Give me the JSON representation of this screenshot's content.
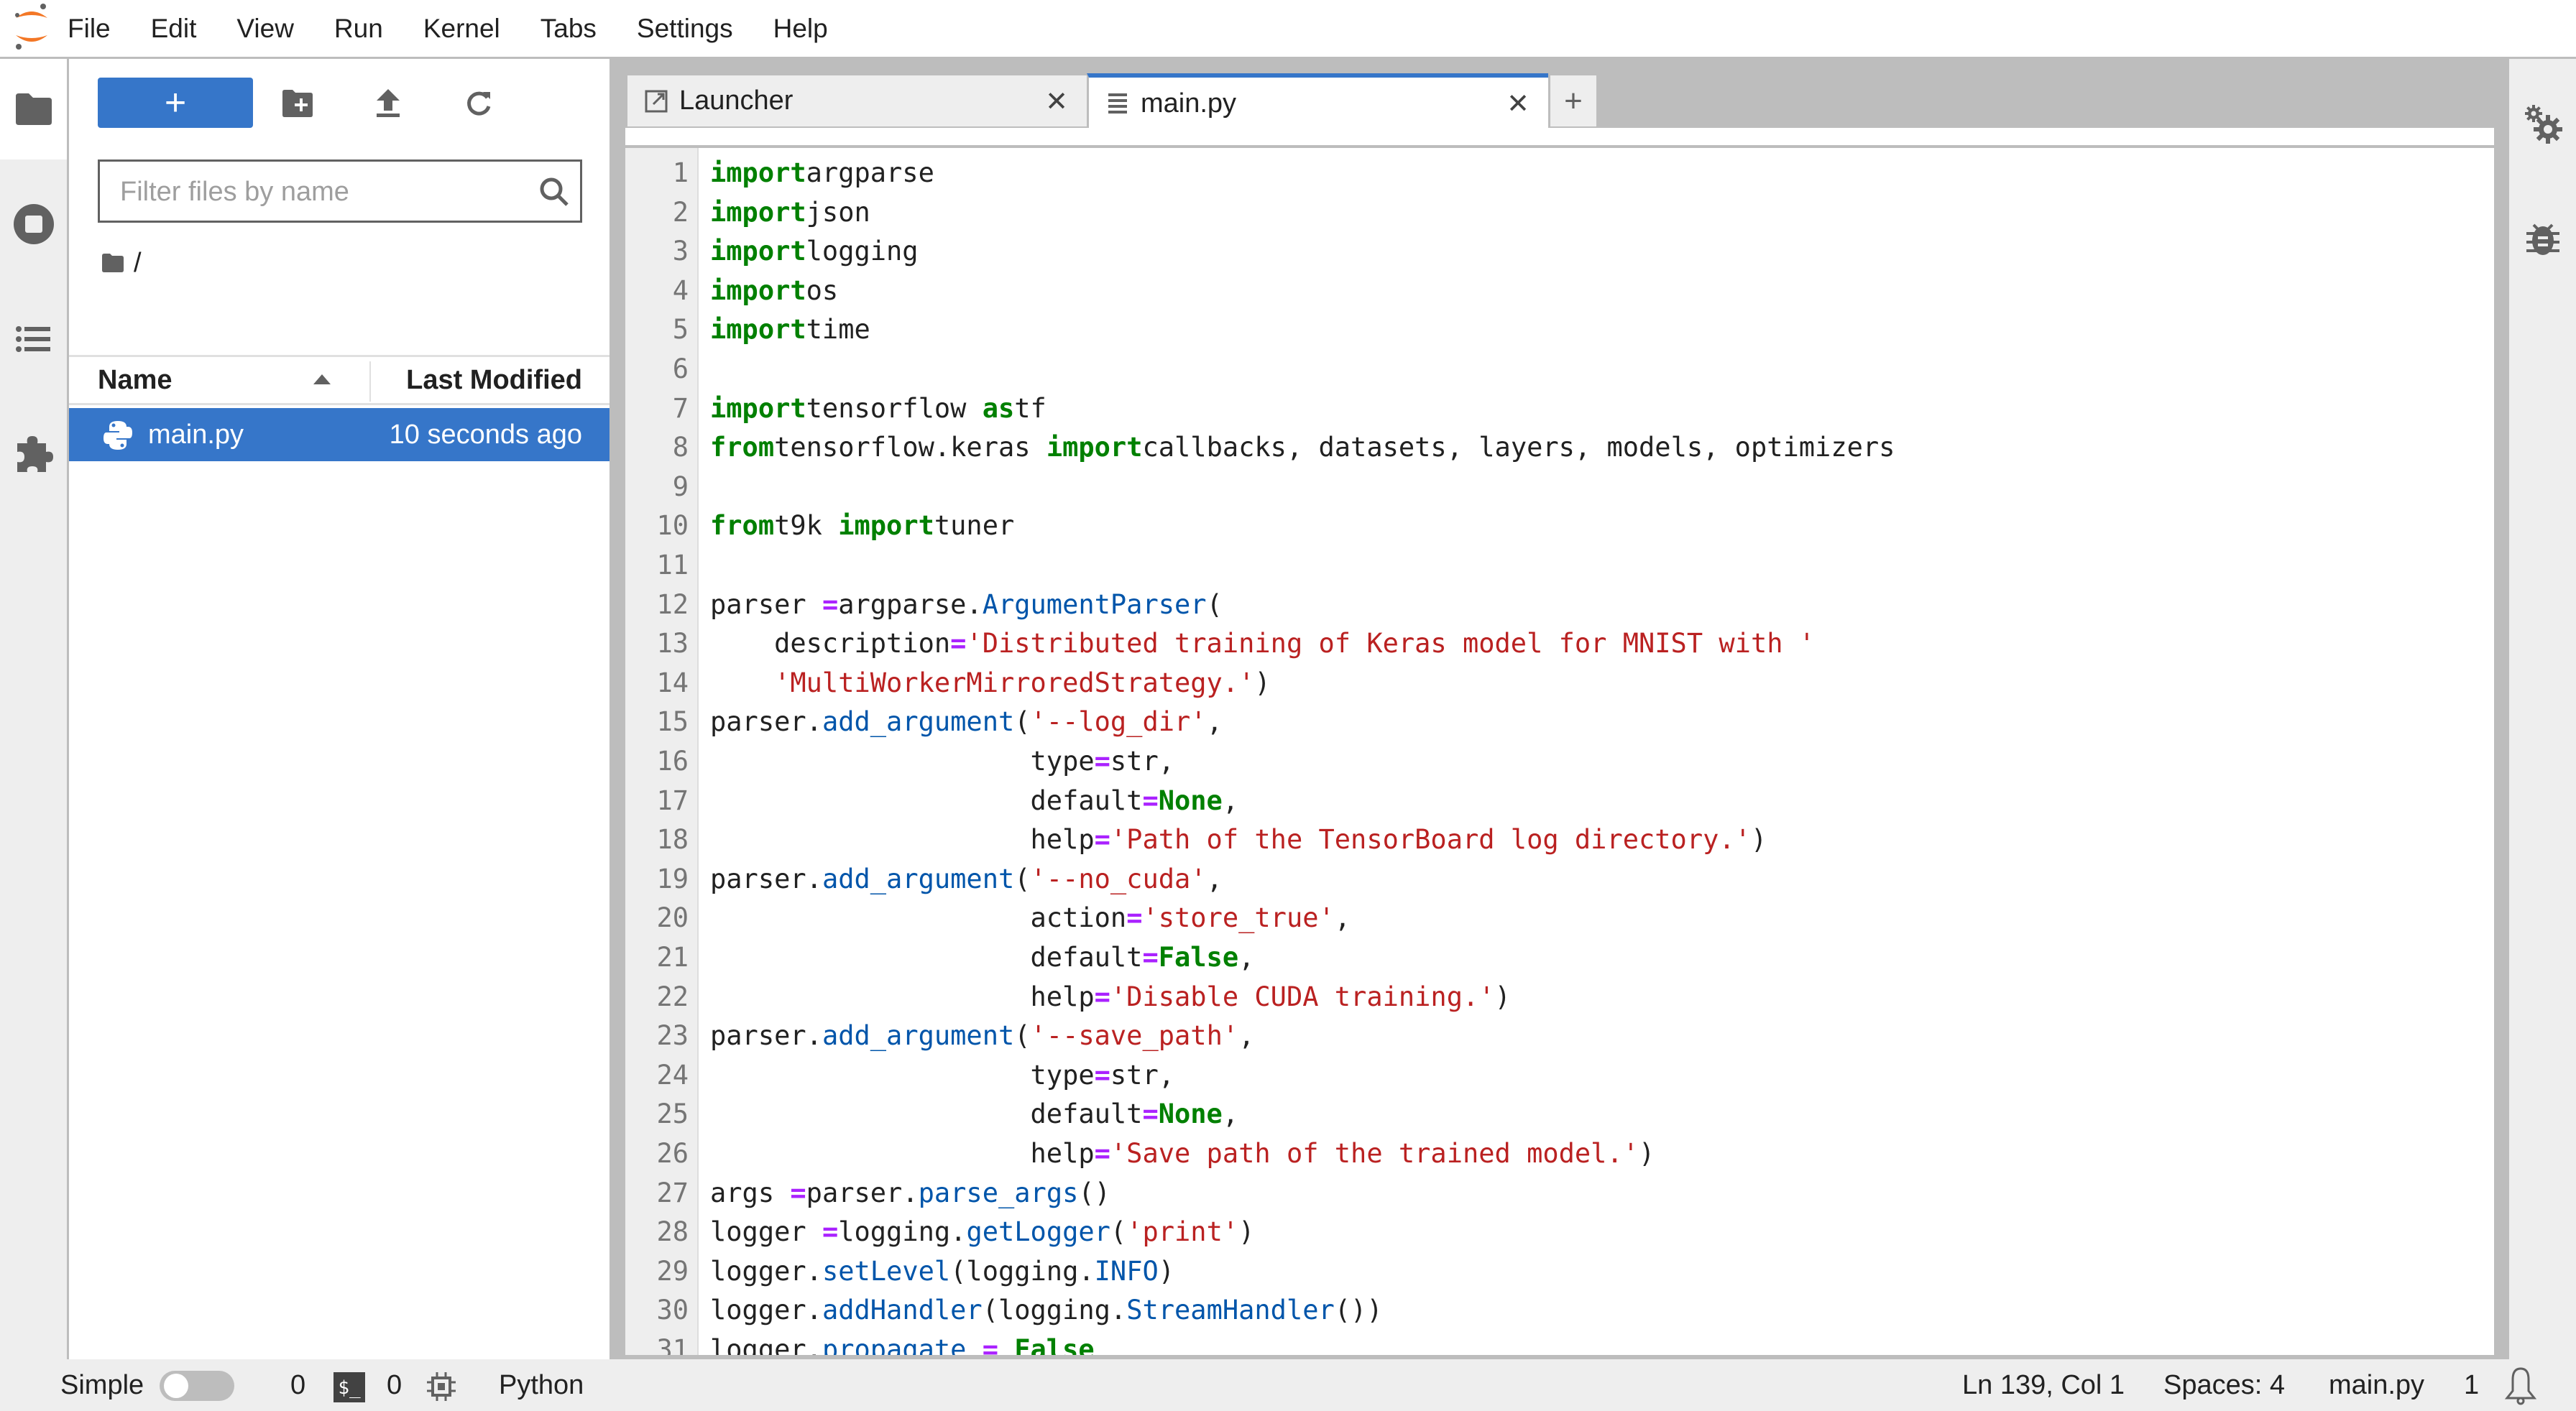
{
  "menubar": {
    "logo": "jupyter-logo",
    "items": [
      "File",
      "Edit",
      "View",
      "Run",
      "Kernel",
      "Tabs",
      "Settings",
      "Help"
    ]
  },
  "left_sidebar": {
    "items": [
      {
        "name": "file-browser",
        "icon": "folder-icon",
        "active": true
      },
      {
        "name": "running-kernels",
        "icon": "stop-circle-icon"
      },
      {
        "name": "table-of-contents",
        "icon": "list-icon"
      },
      {
        "name": "extension-manager",
        "icon": "puzzle-icon"
      }
    ]
  },
  "file_browser": {
    "new_label": "+",
    "toolbar_icons": [
      "new-folder-icon",
      "upload-icon",
      "refresh-icon"
    ],
    "filter_placeholder": "Filter files by name",
    "filter_value": "",
    "breadcrumb": "/",
    "columns": {
      "name": "Name",
      "modified": "Last Modified"
    },
    "files": [
      {
        "name": "main.py",
        "modified": "10 seconds ago",
        "icon": "python-icon",
        "selected": true
      }
    ]
  },
  "tabs": [
    {
      "label": "Launcher",
      "icon": "launcher-icon",
      "active": false
    },
    {
      "label": "main.py",
      "icon": "text-file-icon",
      "active": true
    }
  ],
  "add_tab_label": "+",
  "editor": {
    "language": "python",
    "lines": [
      [
        [
          "kw",
          "import"
        ],
        [
          "",
          "argparse"
        ]
      ],
      [
        [
          "kw",
          "import"
        ],
        [
          "",
          "json"
        ]
      ],
      [
        [
          "kw",
          "import"
        ],
        [
          "",
          "logging"
        ]
      ],
      [
        [
          "kw",
          "import"
        ],
        [
          "",
          "os"
        ]
      ],
      [
        [
          "kw",
          "import"
        ],
        [
          "",
          "time"
        ]
      ],
      [],
      [
        [
          "kw",
          "import"
        ],
        [
          "",
          "tensorflow "
        ],
        [
          "kw",
          "as"
        ],
        [
          "",
          "tf"
        ]
      ],
      [
        [
          "kw",
          "from"
        ],
        [
          "",
          "tensorflow.keras "
        ],
        [
          "kw",
          "import"
        ],
        [
          "",
          "callbacks, datasets, layers, models, optimizers"
        ]
      ],
      [],
      [
        [
          "kw",
          "from"
        ],
        [
          "",
          "t9k "
        ],
        [
          "kw",
          "import"
        ],
        [
          "",
          "tuner"
        ]
      ],
      [],
      [
        [
          "",
          "parser "
        ],
        [
          "op",
          "="
        ],
        [
          "",
          "argparse."
        ],
        [
          "fn",
          "ArgumentParser"
        ],
        [
          "",
          "("
        ]
      ],
      [
        [
          "",
          "    description"
        ],
        [
          "op",
          "="
        ],
        [
          "str",
          "'Distributed training of Keras model for MNIST with '"
        ]
      ],
      [
        [
          "",
          "    "
        ],
        [
          "str",
          "'MultiWorkerMirroredStrategy.'"
        ],
        [
          "",
          ")"
        ]
      ],
      [
        [
          "",
          "parser."
        ],
        [
          "fn",
          "add_argument"
        ],
        [
          "",
          "("
        ],
        [
          "str",
          "'--log_dir'"
        ],
        [
          "",
          ","
        ]
      ],
      [
        [
          "",
          "                    type"
        ],
        [
          "op",
          "="
        ],
        [
          "",
          "str,"
        ]
      ],
      [
        [
          "",
          "                    default"
        ],
        [
          "op",
          "="
        ],
        [
          "cst",
          "None"
        ],
        [
          "",
          ","
        ]
      ],
      [
        [
          "",
          "                    help"
        ],
        [
          "op",
          "="
        ],
        [
          "str",
          "'Path of the TensorBoard log directory.'"
        ],
        [
          "",
          ")"
        ]
      ],
      [
        [
          "",
          "parser."
        ],
        [
          "fn",
          "add_argument"
        ],
        [
          "",
          "("
        ],
        [
          "str",
          "'--no_cuda'"
        ],
        [
          "",
          ","
        ]
      ],
      [
        [
          "",
          "                    action"
        ],
        [
          "op",
          "="
        ],
        [
          "str",
          "'store_true'"
        ],
        [
          "",
          ","
        ]
      ],
      [
        [
          "",
          "                    default"
        ],
        [
          "op",
          "="
        ],
        [
          "cst",
          "False"
        ],
        [
          "",
          ","
        ]
      ],
      [
        [
          "",
          "                    help"
        ],
        [
          "op",
          "="
        ],
        [
          "str",
          "'Disable CUDA training.'"
        ],
        [
          "",
          ")"
        ]
      ],
      [
        [
          "",
          "parser."
        ],
        [
          "fn",
          "add_argument"
        ],
        [
          "",
          "("
        ],
        [
          "str",
          "'--save_path'"
        ],
        [
          "",
          ","
        ]
      ],
      [
        [
          "",
          "                    type"
        ],
        [
          "op",
          "="
        ],
        [
          "",
          "str,"
        ]
      ],
      [
        [
          "",
          "                    default"
        ],
        [
          "op",
          "="
        ],
        [
          "cst",
          "None"
        ],
        [
          "",
          ","
        ]
      ],
      [
        [
          "",
          "                    help"
        ],
        [
          "op",
          "="
        ],
        [
          "str",
          "'Save path of the trained model.'"
        ],
        [
          "",
          ")"
        ]
      ],
      [
        [
          "",
          "args "
        ],
        [
          "op",
          "="
        ],
        [
          "",
          "parser."
        ],
        [
          "fn",
          "parse_args"
        ],
        [
          "",
          "()"
        ]
      ],
      [
        [
          "",
          "logger "
        ],
        [
          "op",
          "="
        ],
        [
          "",
          "logging."
        ],
        [
          "fn",
          "getLogger"
        ],
        [
          "",
          "("
        ],
        [
          "str",
          "'print'"
        ],
        [
          "",
          ")"
        ]
      ],
      [
        [
          "",
          "logger."
        ],
        [
          "fn",
          "setLevel"
        ],
        [
          "",
          "(logging."
        ],
        [
          "fn",
          "INFO"
        ],
        [
          "",
          ")"
        ]
      ],
      [
        [
          "",
          "logger."
        ],
        [
          "fn",
          "addHandler"
        ],
        [
          "",
          "(logging."
        ],
        [
          "fn",
          "StreamHandler"
        ],
        [
          "",
          "())"
        ]
      ],
      [
        [
          "",
          "logger."
        ],
        [
          "fn",
          "propagate"
        ],
        [
          "",
          ""
        ],
        [
          "op",
          " = "
        ],
        [
          "cst",
          "False"
        ]
      ]
    ]
  },
  "right_sidebar": {
    "items": [
      {
        "name": "property-inspector",
        "icon": "gears-icon"
      },
      {
        "name": "debugger",
        "icon": "bug-icon"
      }
    ]
  },
  "statusbar": {
    "mode_label": "Simple",
    "simple_mode_on": false,
    "kernels_count": "0",
    "terminals_count": "0",
    "kernel_name": "Python",
    "cursor_position": "Ln 139, Col 1",
    "indentation": "Spaces: 4",
    "file_name": "main.py",
    "notifications_count": "1"
  },
  "colors": {
    "accent": "#3676c9",
    "keyword": "#008000",
    "string": "#ba2121",
    "function": "#0055aa",
    "operator": "#aa22ff",
    "logo_orange": "#f37726"
  }
}
